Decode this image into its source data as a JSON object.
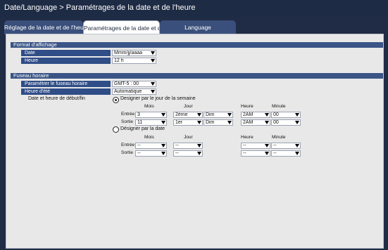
{
  "window": {
    "title": "Date/Language > Paramétrages de la date et de l'heure"
  },
  "tabs": [
    {
      "label": "Réglage de la date et de l'heure",
      "active": false
    },
    {
      "label": "Paramétrages de la date et de l'heure",
      "active": true
    },
    {
      "label": "Language",
      "active": false
    }
  ],
  "format": {
    "section_title": "Format d'affichage",
    "date_label": "Date",
    "date_value": "Mmm/jj/aaaa",
    "time_label": "Heure",
    "time_value": "12 h"
  },
  "timezone": {
    "section_title": "Fuseau horaire",
    "tz_label": "Paramétrer le fuseau horaire",
    "tz_value": "GMT-5 : 00",
    "dst_label": "Heure d'été",
    "dst_value": "Automatique",
    "start_end_label": "Date et heure de début/fin"
  },
  "dst": {
    "weekday_option": "Designer par le jour de la semaine",
    "date_option": "Désigner par la date",
    "col_month": "Mois",
    "col_day": "Jour",
    "col_hour": "Heure",
    "col_minute": "Minute",
    "row_start": "Entrée",
    "row_end": "Sortie",
    "weekday_start": {
      "month": "3",
      "week": "2ème",
      "weekday": "Dim",
      "hour": "2AM",
      "minute": "00"
    },
    "weekday_end": {
      "month": "11",
      "week": "1er",
      "weekday": "Dim",
      "hour": "2AM",
      "minute": "00"
    },
    "date_start": {
      "month": "--",
      "day": "--",
      "hour": "--",
      "minute": "--"
    },
    "date_end": {
      "month": "--",
      "day": "--",
      "hour": "--",
      "minute": "--"
    }
  },
  "colors": {
    "titlebar": "#1e2b44",
    "section_header": "#3a5486",
    "label_bg": "#2f4d87",
    "content_bg": "#e8e8e8"
  },
  "icons": {
    "dropdown": "chevron-down-icon",
    "radio": "radio-icon"
  }
}
